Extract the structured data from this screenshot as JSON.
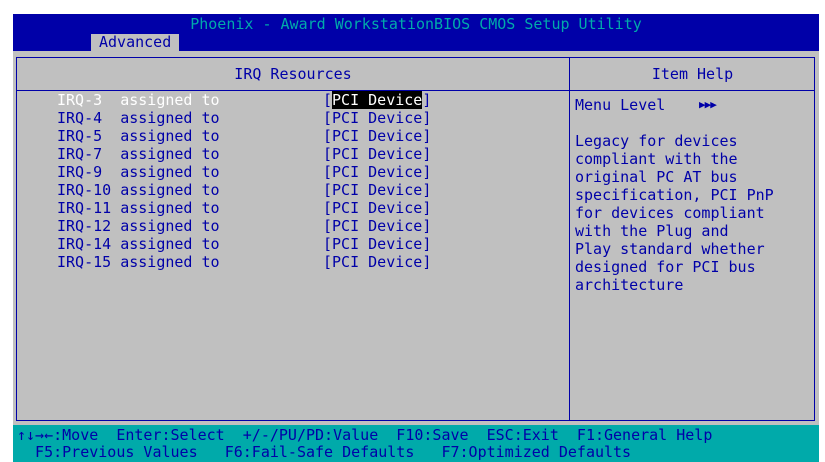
{
  "title": "Phoenix - Award WorkstationBIOS CMOS Setup Utility",
  "menu": {
    "tab": "Advanced"
  },
  "left_panel": {
    "title": "IRQ Resources"
  },
  "right_panel": {
    "title": "Item Help"
  },
  "rows": [
    {
      "label": "IRQ-3  assigned to",
      "value": "PCI Device"
    },
    {
      "label": "IRQ-4  assigned to",
      "value": "PCI Device"
    },
    {
      "label": "IRQ-5  assigned to",
      "value": "PCI Device"
    },
    {
      "label": "IRQ-7  assigned to",
      "value": "PCI Device"
    },
    {
      "label": "IRQ-9  assigned to",
      "value": "PCI Device"
    },
    {
      "label": "IRQ-10 assigned to",
      "value": "PCI Device"
    },
    {
      "label": "IRQ-11 assigned to",
      "value": "PCI Device"
    },
    {
      "label": "IRQ-12 assigned to",
      "value": "PCI Device"
    },
    {
      "label": "IRQ-14 assigned to",
      "value": "PCI Device"
    },
    {
      "label": "IRQ-15 assigned to",
      "value": "PCI Device"
    }
  ],
  "help": {
    "menu_level_label": "Menu Level",
    "menu_level_arrows": "▶▶▶",
    "text": "Legacy for devices\ncompliant with the\noriginal PC AT bus\nspecification, PCI PnP\nfor devices compliant\nwith the Plug and\nPlay standard whether\ndesigned for PCI bus\narchitecture"
  },
  "status": {
    "line1": "↑↓→←:Move  Enter:Select  +/-/PU/PD:Value  F10:Save  ESC:Exit  F1:General Help",
    "line2": "  F5:Previous Values   F6:Fail-Safe Defaults   F7:Optimized Defaults"
  },
  "colors": {
    "blue": "#0000a8",
    "gray": "#c0c0c0",
    "cyan": "#00aaaa",
    "highlight": "#000000"
  }
}
